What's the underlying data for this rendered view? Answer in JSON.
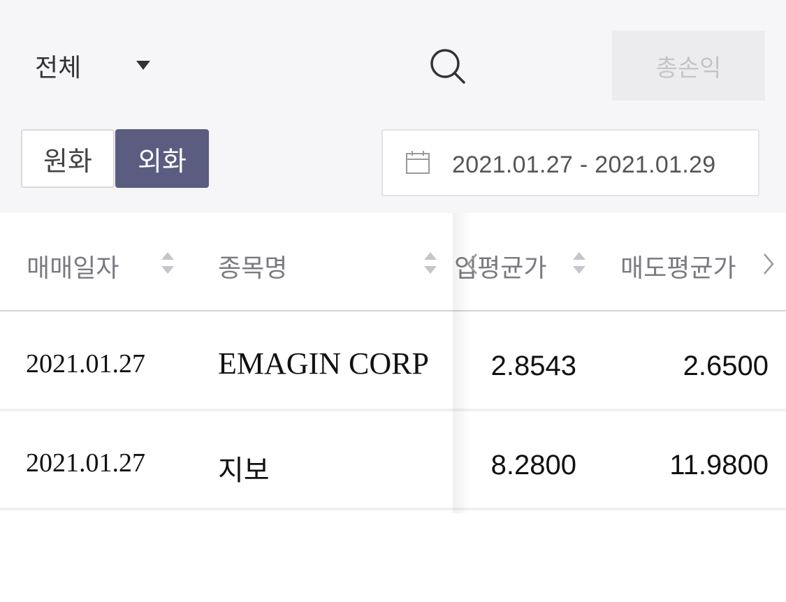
{
  "filter": {
    "selected": "전체",
    "icon": "caret-down-icon"
  },
  "search": {
    "icon": "search-icon"
  },
  "total_button": {
    "label": "총손익"
  },
  "currency_tabs": [
    {
      "label": "원화",
      "active": false
    },
    {
      "label": "외화",
      "active": true
    }
  ],
  "date_range": {
    "icon": "calendar-icon",
    "text": "2021.01.27 - 2021.01.29"
  },
  "table": {
    "headers": [
      "매매일자",
      "종목명",
      "입평균가",
      "매도평균가"
    ],
    "rows": [
      {
        "date": "2021.01.27",
        "name": "EMAGIN CORP",
        "buy_avg": "2.8543",
        "sell_avg": "2.6500"
      },
      {
        "date": "2021.01.27",
        "name": "지보",
        "buy_avg": "8.2800",
        "sell_avg": "11.9800"
      }
    ]
  },
  "colors": {
    "accent": "#5a5d80",
    "background_top": "#f6f6f8",
    "disabled_button": "#ececee"
  }
}
